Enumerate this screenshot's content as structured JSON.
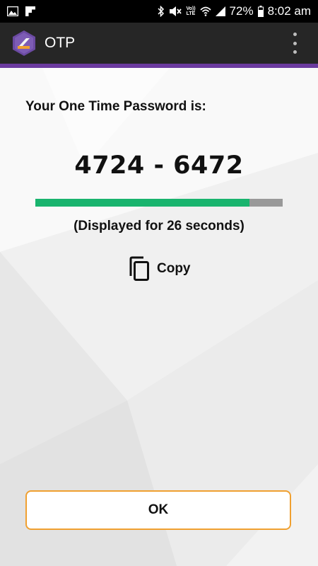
{
  "status_bar": {
    "left_icons": [
      "image-icon",
      "flipboard-icon"
    ],
    "right_icons": [
      "bluetooth-icon",
      "mute-icon",
      "volte-icon",
      "wifi-icon",
      "signal-icon",
      "battery-icon"
    ],
    "volte_label_top": "Vo))",
    "volte_label_bottom": "LTE",
    "battery_percent": "72%",
    "time": "8:02 am"
  },
  "app_bar": {
    "title": "OTP",
    "accent_color": "#6b3a9e",
    "logo_icon": "app-logo-icon",
    "menu_icon": "overflow-menu-icon"
  },
  "main": {
    "label": "Your One Time Password is:",
    "otp_code": "4724 - 6472",
    "progress_fraction": 0.866,
    "progress_color": "#19b46e",
    "caption": "(Displayed for 26 seconds)",
    "copy_label": "Copy",
    "copy_icon": "copy-icon",
    "ok_label": "OK",
    "ok_border_color": "#f0a030"
  }
}
